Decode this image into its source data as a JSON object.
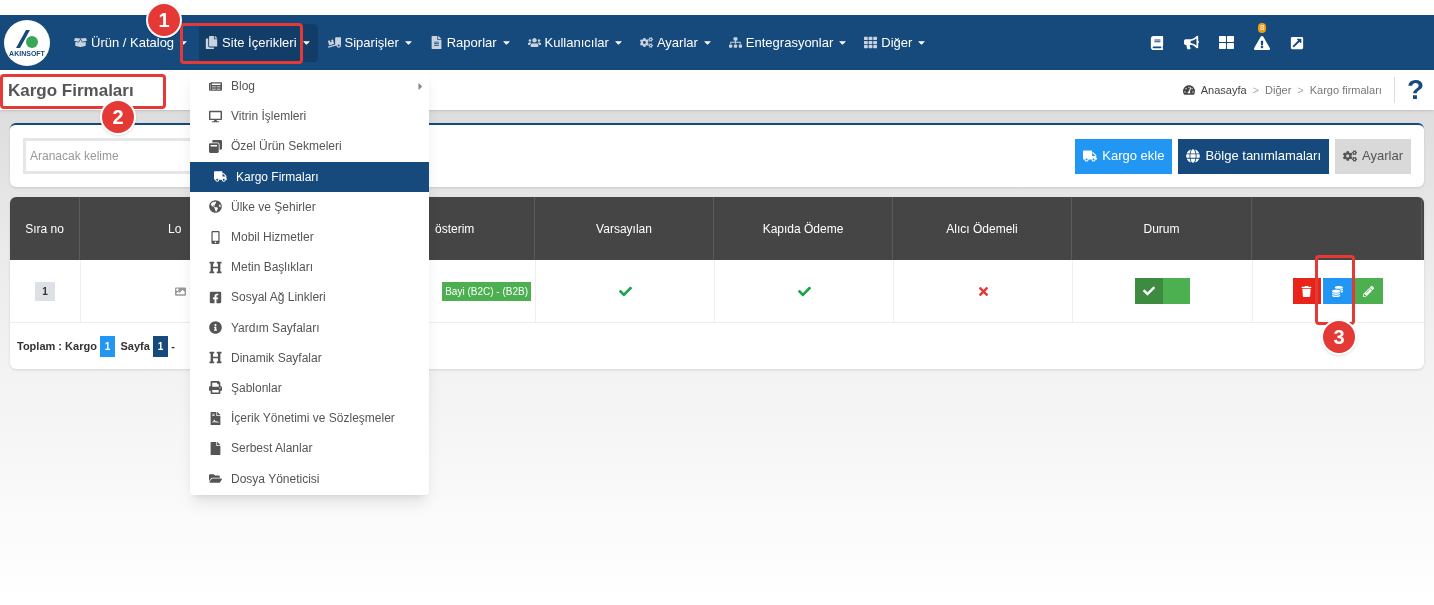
{
  "logo_text": "AKINSOFT",
  "nav": [
    {
      "label": "Ürün / Katalog",
      "selected": false
    },
    {
      "label": "Site İçerikleri",
      "selected": true
    },
    {
      "label": "Siparişler",
      "selected": false
    },
    {
      "label": "Raporlar",
      "selected": false
    },
    {
      "label": "Kullanıcılar",
      "selected": false
    },
    {
      "label": "Ayarlar",
      "selected": false
    },
    {
      "label": "Entegrasyonlar",
      "selected": false
    },
    {
      "label": "Diğer",
      "selected": false
    }
  ],
  "notification_count": "8",
  "page_title": "Kargo Firmaları",
  "breadcrumb": [
    "Anasayfa",
    "Diğer",
    "Kargo firmaları"
  ],
  "breadcrumb_separator": ">",
  "help": "?",
  "search": {
    "placeholder": "Aranacak kelime"
  },
  "toolbar_buttons": [
    {
      "label": "Kargo ekle",
      "kind": "primary"
    },
    {
      "label": "Bölge tanımlamaları",
      "kind": "dark"
    },
    {
      "label": "Ayarlar",
      "kind": "plain"
    }
  ],
  "table": {
    "columns": [
      "Sıra no",
      "Lo",
      "österim",
      "Varsayılan",
      "Kapıda Ödeme",
      "Alıcı Ödemeli",
      "Durum",
      ""
    ],
    "rows": [
      {
        "order": "1",
        "display": "Bayi (B2C) - (B2B)",
        "default": true,
        "cash_on_delivery": true,
        "receiver_pays": false,
        "status_on": true
      }
    ]
  },
  "footer": {
    "total_label": "Toplam : Kargo",
    "total": "1",
    "page_label": "Sayfa",
    "page": "1",
    "dash": "-"
  },
  "menu": [
    {
      "label": "Blog",
      "has_submenu": true,
      "selected": false
    },
    {
      "label": "Vitrin İşlemleri",
      "has_submenu": false,
      "selected": false
    },
    {
      "label": "Özel Ürün Sekmeleri",
      "has_submenu": false,
      "selected": false
    },
    {
      "label": "Kargo Firmaları",
      "has_submenu": false,
      "selected": true
    },
    {
      "label": "Ülke ve Şehirler",
      "has_submenu": false,
      "selected": false
    },
    {
      "label": "Mobil Hizmetler",
      "has_submenu": false,
      "selected": false
    },
    {
      "label": "Metin Başlıkları",
      "has_submenu": false,
      "selected": false
    },
    {
      "label": "Sosyal Ağ Linkleri",
      "has_submenu": false,
      "selected": false
    },
    {
      "label": "Yardım Sayfaları",
      "has_submenu": false,
      "selected": false
    },
    {
      "label": "Dinamik Sayfalar",
      "has_submenu": false,
      "selected": false
    },
    {
      "label": "Şablonlar",
      "has_submenu": false,
      "selected": false
    },
    {
      "label": "İçerik Yönetimi ve Sözleşmeler",
      "has_submenu": false,
      "selected": false
    },
    {
      "label": "Serbest Alanlar",
      "has_submenu": false,
      "selected": false
    },
    {
      "label": "Dosya Yöneticisi",
      "has_submenu": false,
      "selected": false
    }
  ],
  "annotations": [
    "1",
    "2",
    "3"
  ]
}
